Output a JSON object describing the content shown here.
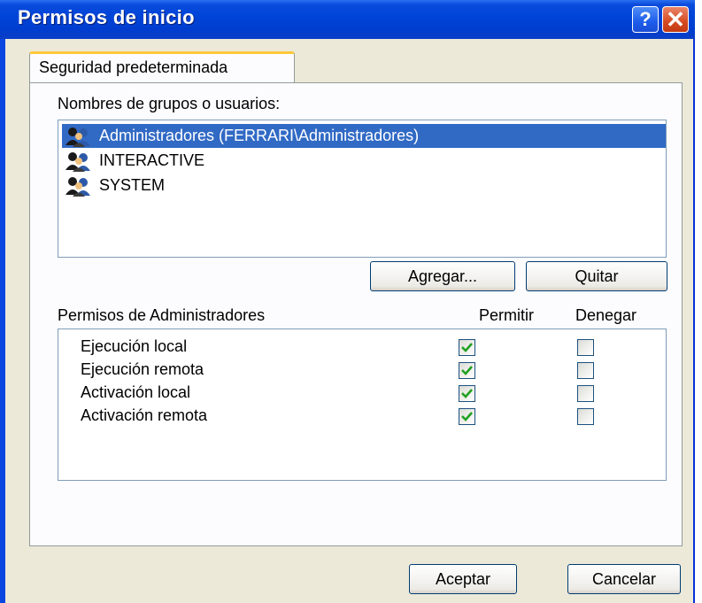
{
  "window": {
    "title": "Permisos de inicio",
    "help_glyph": "?",
    "close_glyph": "✕"
  },
  "tab": {
    "label": "Seguridad predeterminada"
  },
  "groups": {
    "label": "Nombres de grupos o usuarios:",
    "items": [
      {
        "label": "Administradores (FERRARI\\Administradores)",
        "selected": true,
        "icon": "user-group-icon"
      },
      {
        "label": "INTERACTIVE",
        "selected": false,
        "icon": "user-group-icon"
      },
      {
        "label": "SYSTEM",
        "selected": false,
        "icon": "user-group-icon"
      }
    ],
    "add_label": "Agregar...",
    "remove_label": "Quitar"
  },
  "permissions": {
    "label": "Permisos de Administradores",
    "allow_header": "Permitir",
    "deny_header": "Denegar",
    "rows": [
      {
        "label": "Ejecución local",
        "allow": true,
        "deny": false
      },
      {
        "label": "Ejecución remota",
        "allow": true,
        "deny": false
      },
      {
        "label": "Activación local",
        "allow": true,
        "deny": false
      },
      {
        "label": "Activación remota",
        "allow": true,
        "deny": false
      }
    ]
  },
  "footer": {
    "ok_label": "Aceptar",
    "cancel_label": "Cancelar"
  },
  "colors": {
    "titlebar": "#0045d8",
    "selection": "#316ac5",
    "check": "#21a121",
    "dialog_bg": "#ece9d8"
  }
}
